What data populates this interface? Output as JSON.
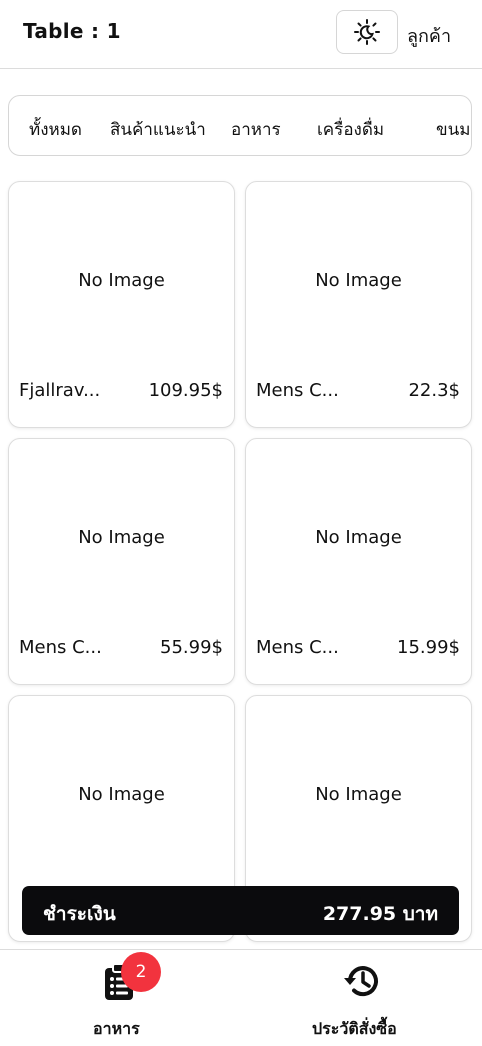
{
  "header": {
    "table_title": "Table : 1",
    "theme_icon": "sun-moon-icon",
    "customer_label": "ลูกค้า"
  },
  "tabs": [
    "ทั้งหมด",
    "สินค้าแนะนำ",
    "อาหาร",
    "เครื่องดื่ม",
    "ขนม"
  ],
  "products": [
    {
      "image_text": "No Image",
      "name": "Fjallrav...",
      "price": "109.95$"
    },
    {
      "image_text": "No Image",
      "name": "Mens C...",
      "price": "22.3$"
    },
    {
      "image_text": "No Image",
      "name": "Mens C...",
      "price": "55.99$"
    },
    {
      "image_text": "No Image",
      "name": "Mens C...",
      "price": "15.99$"
    },
    {
      "image_text": "No Image",
      "name": "",
      "price": ""
    },
    {
      "image_text": "No Image",
      "name": "",
      "price": ""
    }
  ],
  "payment": {
    "label": "ชำระเงิน",
    "total": "277.95 บาท"
  },
  "bottom_nav": {
    "food": {
      "label": "อาหาร",
      "badge": "2",
      "icon": "clipboard-list-icon"
    },
    "history": {
      "label": "ประวัติสั่งซื้อ",
      "icon": "history-icon"
    }
  },
  "colors": {
    "badge": "#f2333e",
    "pay_bar": "#0b0b0d",
    "border": "#dddddd"
  }
}
